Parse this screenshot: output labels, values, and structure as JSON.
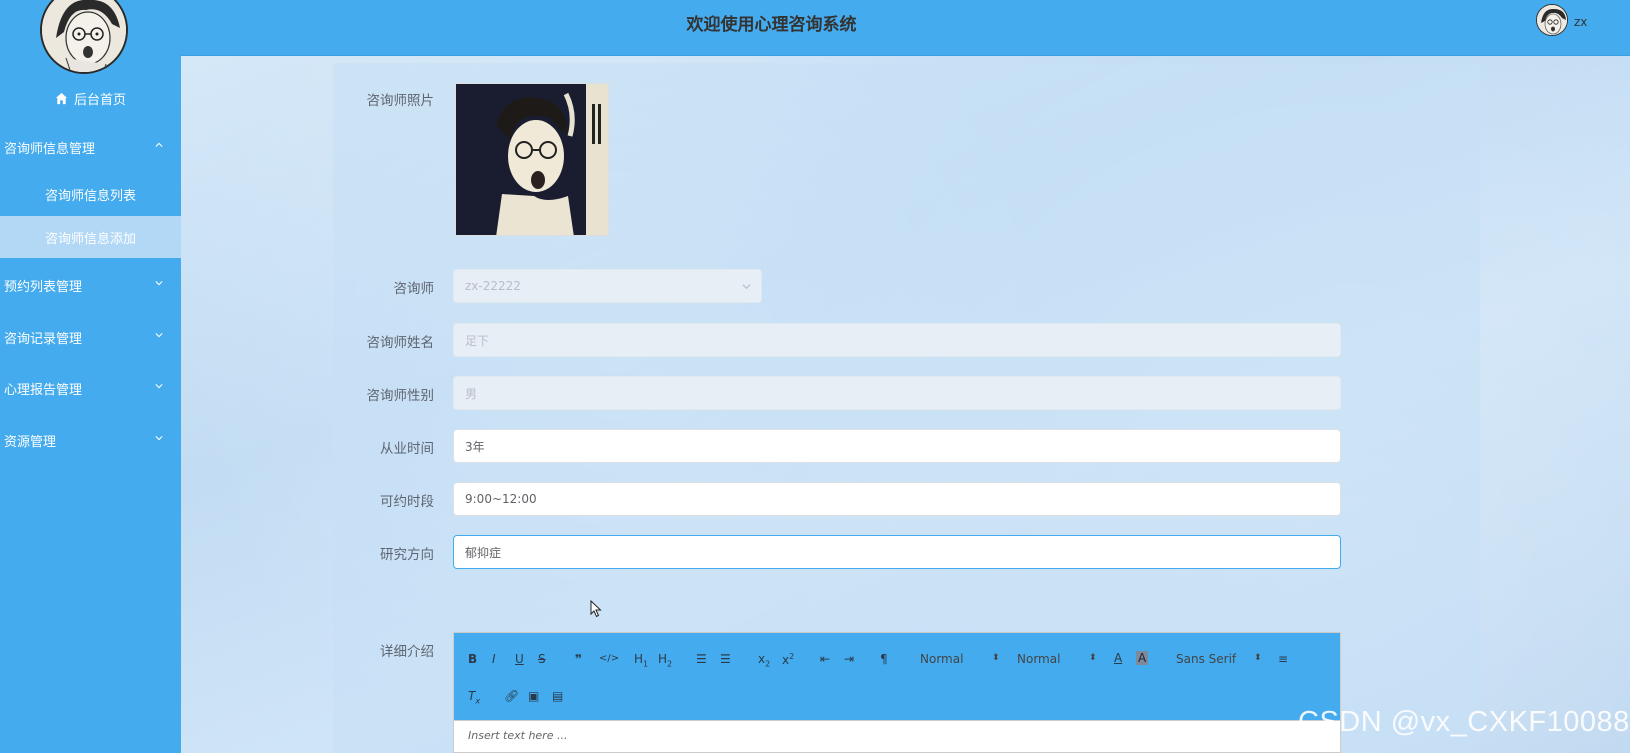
{
  "header": {
    "title": "欢迎使用心理咨询系统",
    "username": "zx"
  },
  "sidebar": {
    "home": "后台首页",
    "menus": [
      {
        "label": "咨询师信息管理",
        "expanded": true,
        "children": [
          {
            "label": "咨询师信息列表"
          },
          {
            "label": "咨询师信息添加",
            "active": true
          }
        ]
      },
      {
        "label": "预约列表管理",
        "expanded": false
      },
      {
        "label": "咨询记录管理",
        "expanded": false
      },
      {
        "label": "心理报告管理",
        "expanded": false
      },
      {
        "label": "资源管理",
        "expanded": false
      }
    ]
  },
  "form": {
    "photo_label": "咨询师照片",
    "counselor_label": "咨询师",
    "counselor_value": "zx-22222",
    "name_label": "咨询师姓名",
    "name_value": "足下",
    "gender_label": "咨询师性别",
    "gender_value": "男",
    "years_label": "从业时间",
    "years_value": "3年",
    "hours_label": "可约时段",
    "hours_value": "9:00~12:00",
    "research_label": "研究方向",
    "research_value": "郁抑症",
    "intro_label": "详细介绍"
  },
  "editor": {
    "size_select": "Normal",
    "header_select": "Normal",
    "font_select": "Sans Serif",
    "placeholder": "Insert text here ..."
  },
  "watermark": "CSDN @vx_CXKF10088",
  "colors": {
    "primary": "#44abee",
    "active_sub": "#b2d8f5"
  }
}
